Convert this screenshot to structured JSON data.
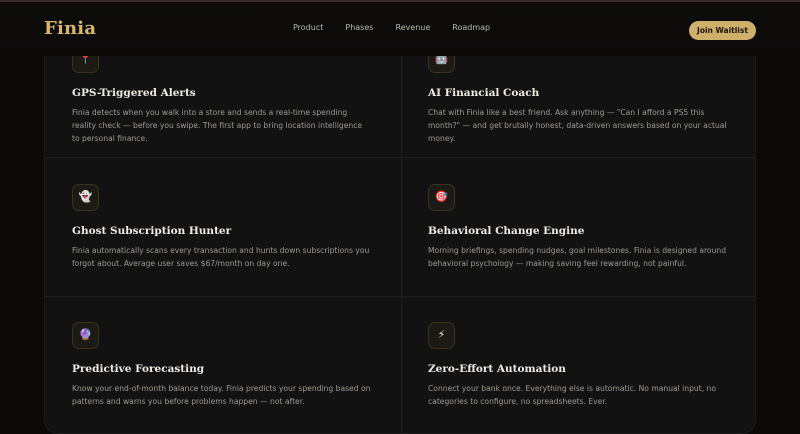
{
  "brand": {
    "name": "Finia"
  },
  "nav": {
    "items": [
      {
        "label": "Product"
      },
      {
        "label": "Phases"
      },
      {
        "label": "Revenue"
      },
      {
        "label": "Roadmap"
      }
    ],
    "cta_label": "Join Waitlist"
  },
  "colors": {
    "accent": "#cfb06a",
    "background": "#0b0a09",
    "card": "#121212"
  },
  "features": [
    {
      "icon": "pin-icon",
      "glyph": "📍",
      "title": "GPS-Triggered Alerts",
      "desc": "Finia detects when you walk into a store and sends a real-time spending reality check — before you swipe. The first app to bring location intelligence to personal finance."
    },
    {
      "icon": "robot-icon",
      "glyph": "🤖",
      "title": "AI Financial Coach",
      "desc": "Chat with Finia like a best friend. Ask anything — \"Can I afford a PS5 this month?\" — and get brutally honest, data-driven answers based on your actual money."
    },
    {
      "icon": "ghost-icon",
      "glyph": "👻",
      "title": "Ghost Subscription Hunter",
      "desc": "Finia automatically scans every transaction and hunts down subscriptions you forgot about. Average user saves $67/month on day one."
    },
    {
      "icon": "target-icon",
      "glyph": "🎯",
      "title": "Behavioral Change Engine",
      "desc": "Morning briefings, spending nudges, goal milestones. Finia is designed around behavioral psychology — making saving feel rewarding, not painful."
    },
    {
      "icon": "crystal-ball-icon",
      "glyph": "🔮",
      "title": "Predictive Forecasting",
      "desc": "Know your end-of-month balance today. Finia predicts your spending based on patterns and warns you before problems happen — not after."
    },
    {
      "icon": "lightning-icon",
      "glyph": "⚡",
      "title": "Zero-Effort Automation",
      "desc": "Connect your bank once. Everything else is automatic. No manual input, no categories to configure, no spreadsheets. Ever."
    }
  ]
}
